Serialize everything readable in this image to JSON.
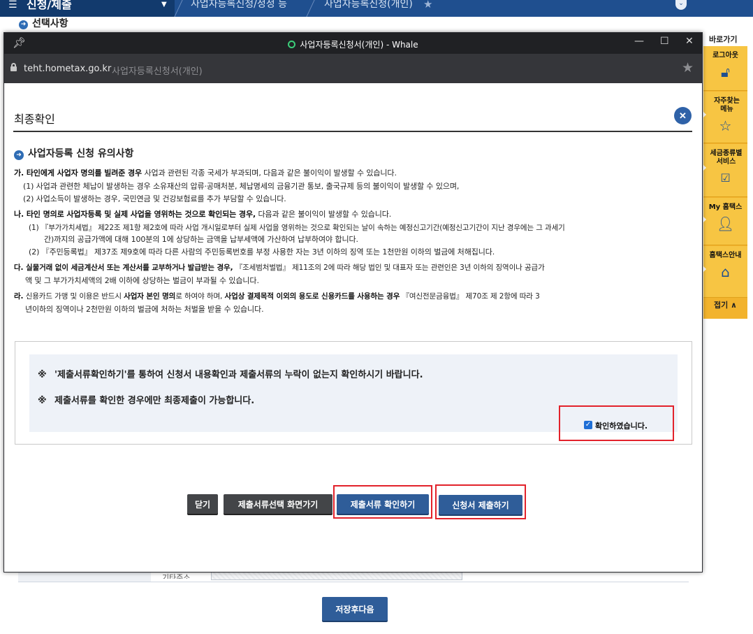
{
  "background": {
    "menu_label": "신청/제출",
    "breadcrumbs": [
      "사업자등록신청/정정 등",
      "사업자등록신청(개인)"
    ],
    "section_title": "선택사항",
    "field_label": "기타주소",
    "save_next_label": "저장후다음"
  },
  "quick_menu": {
    "title": "바로가기",
    "items": [
      {
        "label": "로그아웃",
        "icon": "lock-icon"
      },
      {
        "label": "자주찾는 메뉴",
        "icon": "star-icon"
      },
      {
        "label": "세금종류별 서비스",
        "icon": "checkbox-icon"
      },
      {
        "label": "My 홈택스",
        "icon": "person-icon"
      },
      {
        "label": "홈택스안내",
        "icon": "home-icon"
      }
    ],
    "fold_label": "접기 ∧"
  },
  "window": {
    "title": "사업자등록신청서(개인) - Whale",
    "domain": "teht.hometax.go.kr",
    "page_title": "사업자등록신청서(개인)"
  },
  "dialog": {
    "title": "최종확인",
    "notice_heading": "사업자등록 신청 유의사항",
    "notices": [
      {
        "bold": "가. 타인에게 사업자 명의를 빌려준 경우",
        "text": " 사업과 관련된 각종 국세가 부과되며, 다음과 같은 불이익이 발생할 수 있습니다."
      },
      {
        "text": "(1) 사업과 관련한 체납이 발생하는 경우 소유재산의 압류·공매처분, 체납명세의 금융기관 통보, 출국규제 등의 불이익이 발생할 수 있으며,"
      },
      {
        "text": "(2) 사업소득이 발생하는 경우, 국민연금 및 건강보험료를 추가 부담할 수 있습니다."
      },
      {
        "bold": "나. 타인 명의로 사업자등록 및 실제 사업을 영위하는 것으로 확인되는 경우,",
        "text": " 다음과 같은 불이익이 발생할 수 있습니다."
      },
      {
        "text": "(1) 『부가가치세법』 제22조 제1항 제2호에 따라 사업 개시일로부터 실제 사업을 영위하는 것으로 확인되는 날이 속하는 예정신고기간(예정신고기간이 지난 경우에는 그 과세기"
      },
      {
        "text": "간)까지의 공급가액에 대해 100분의 1에 상당하는 금액을 납부세액에 가산하여 납부하여야 합니다."
      },
      {
        "text": "(2) 『주민등록법』 제37조 제9호에 따라 다른 사람의 주민등록번호를 부정 사용한 자는 3년 이하의 징역 또는 1천만원 이하의 벌금에 처해집니다."
      },
      {
        "bold": "다. 실물거래 없이 세금계산서 또는 계산서를 교부하거나 발급받는 경우,",
        "text": " 『조세범처벌법』 제11조의 2에 따라 해당 법인 및 대표자 또는 관련인은 3년 이하의 징역이나 공급가"
      },
      {
        "text": "액 및 그 부가가치세액의 2배 이하에 상당하는 벌금이 부과될 수 있습니다."
      },
      {
        "bold": "라.",
        "text": " 신용카드 가맹 및 이용은 반드시 ",
        "bold2": "사업자 본인 명의",
        "text2": "로 하여야 하며, ",
        "bold3": "사업상 결제목적 이외의 용도로 신용카드를 사용하는 경우",
        "text3": " 『여신전문금융법』 제70조 제 2항에 따라 3"
      },
      {
        "text": "년이하의 징역이나 2천만원 이하의 벌금에 처하는 처벌을 받을 수 있습니다."
      }
    ],
    "confirm_mark": "※",
    "confirm_msg_1": "'제출서류확인하기'를 통하여 신청서 내용확인과 제출서류의 누락이 없는지 확인하시기 바랍니다.",
    "confirm_msg_2": "제출서류를 확인한 경우에만 최종제출이 가능합니다.",
    "ack_label": "확인하였습니다.",
    "ack_checked": true,
    "buttons": {
      "close": "닫기",
      "go_docs_select": "제출서류선택 화면가기",
      "check_docs": "제출서류 확인하기",
      "submit": "신청서 제출하기"
    }
  }
}
